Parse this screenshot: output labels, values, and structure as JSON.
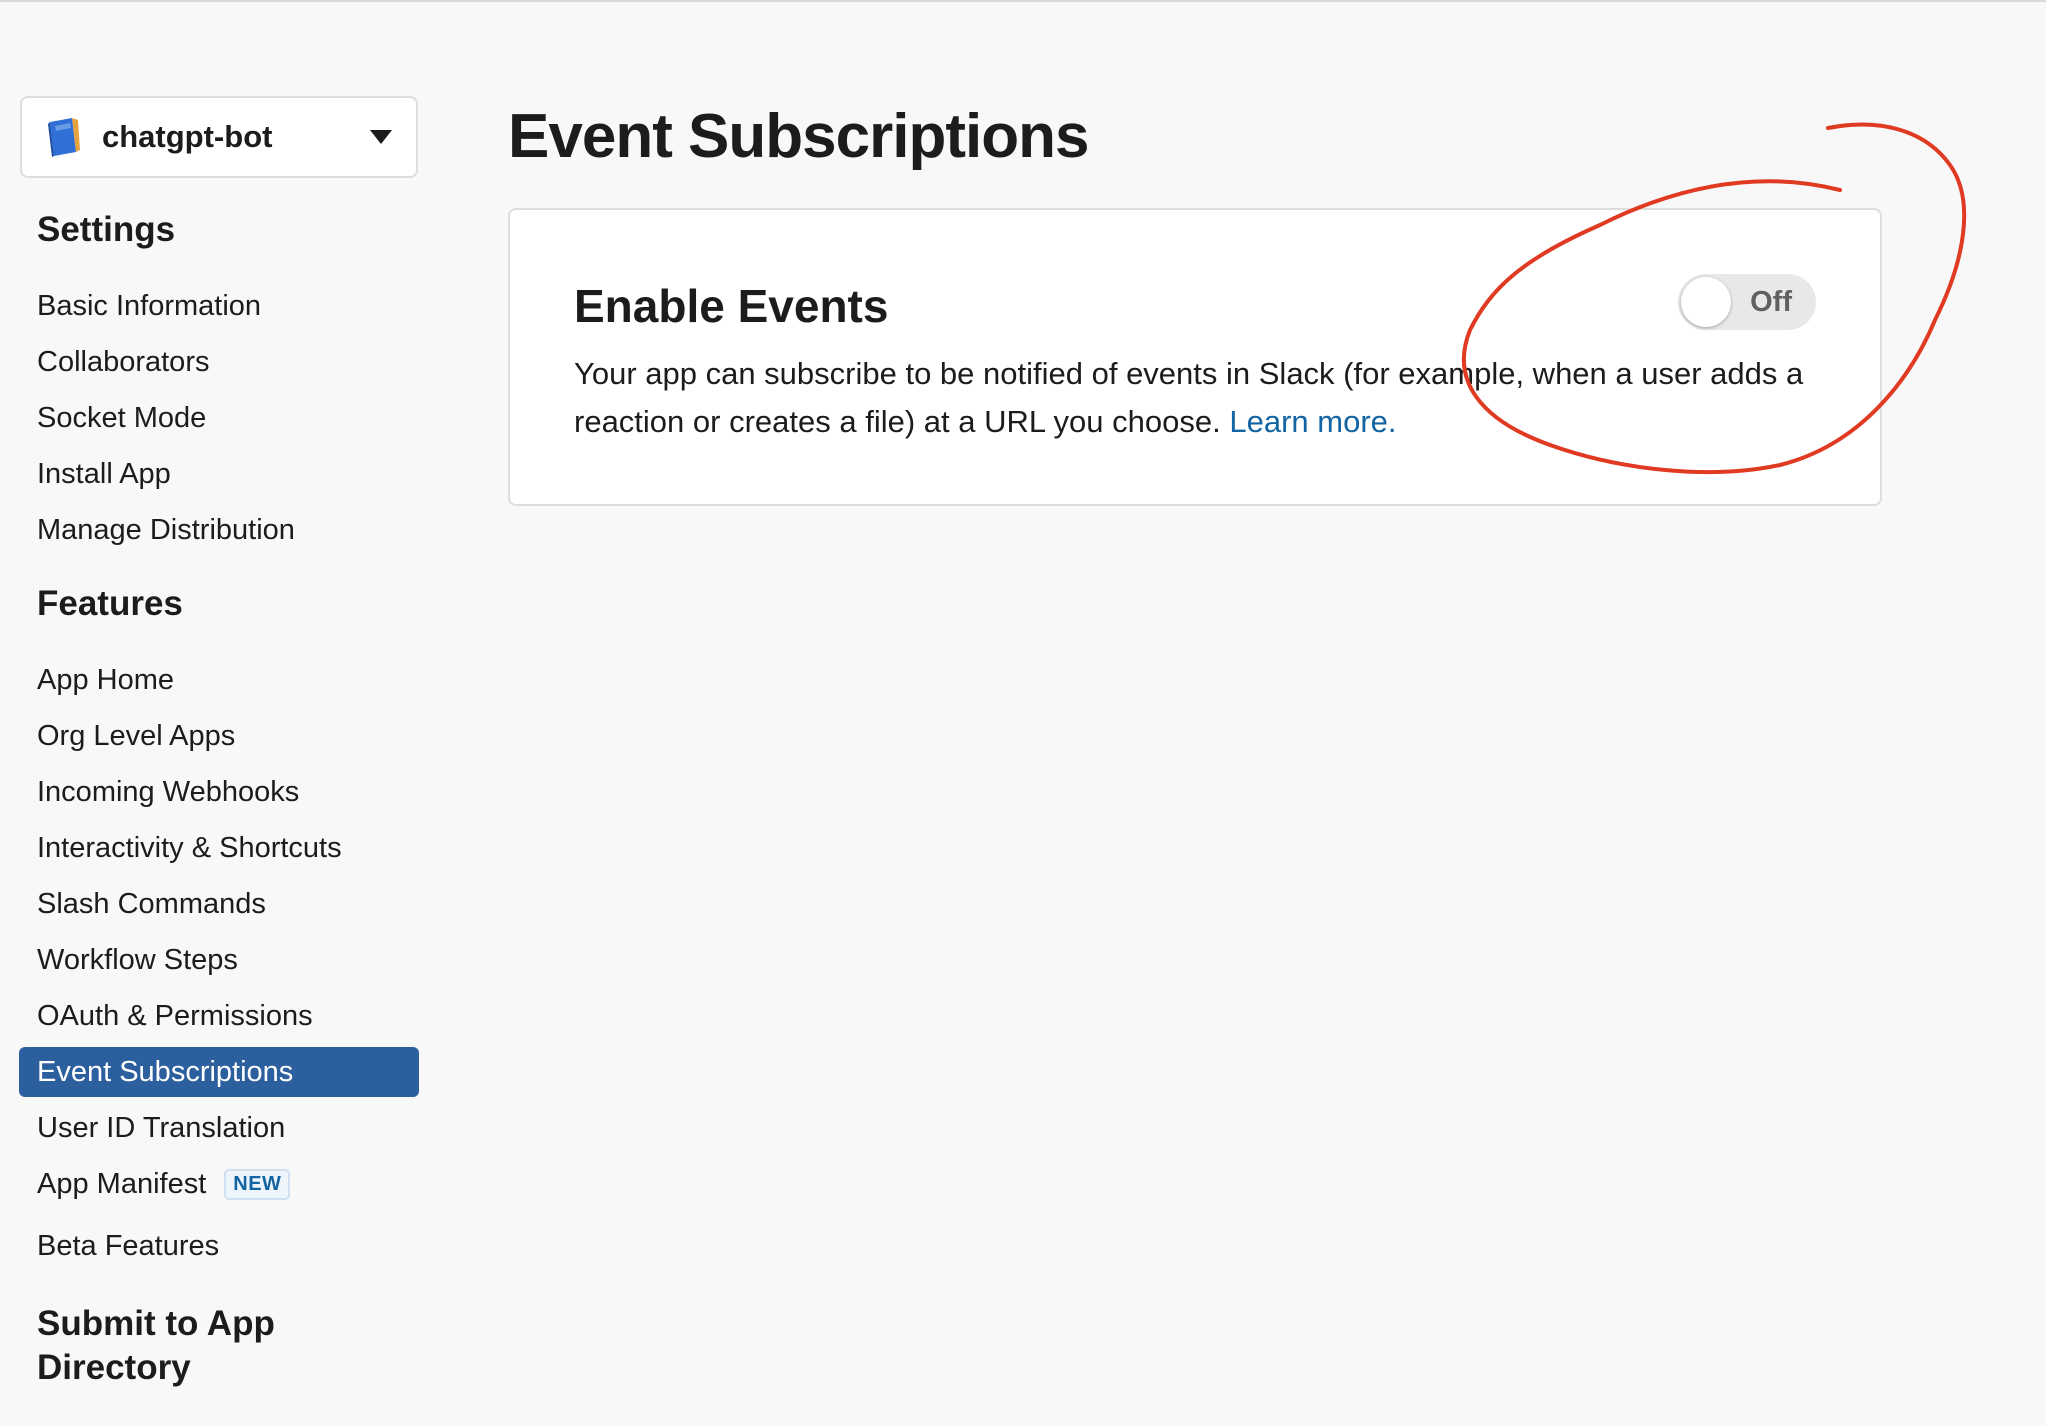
{
  "app_selector": {
    "name": "chatgpt-bot",
    "icon": "notebook-icon"
  },
  "sidebar": {
    "settings_heading": "Settings",
    "settings_items": [
      {
        "label": "Basic Information"
      },
      {
        "label": "Collaborators"
      },
      {
        "label": "Socket Mode"
      },
      {
        "label": "Install App"
      },
      {
        "label": "Manage Distribution"
      }
    ],
    "features_heading": "Features",
    "features_items": [
      {
        "label": "App Home"
      },
      {
        "label": "Org Level Apps"
      },
      {
        "label": "Incoming Webhooks"
      },
      {
        "label": "Interactivity & Shortcuts"
      },
      {
        "label": "Slash Commands"
      },
      {
        "label": "Workflow Steps"
      },
      {
        "label": "OAuth & Permissions"
      },
      {
        "label": "Event Subscriptions",
        "active": true
      },
      {
        "label": "User ID Translation"
      },
      {
        "label": "App Manifest",
        "badge": "NEW"
      },
      {
        "label": "Beta Features"
      }
    ],
    "submit_heading_line1": "Submit to App",
    "submit_heading_line2": "Directory"
  },
  "main": {
    "title": "Event Subscriptions",
    "card": {
      "title": "Enable Events",
      "description_part1": "Your app can subscribe to be notified of events in Slack (for example, when a user adds a reaction or creates a file) at a URL you choose.",
      "link_text": "Learn more.",
      "toggle": {
        "state": "off",
        "label": "Off"
      }
    }
  },
  "colors": {
    "active_nav_bg": "#2c5f9e",
    "link": "#1264a3",
    "annotation_red": "#e03a22",
    "page_bg": "#f8f8f8"
  }
}
